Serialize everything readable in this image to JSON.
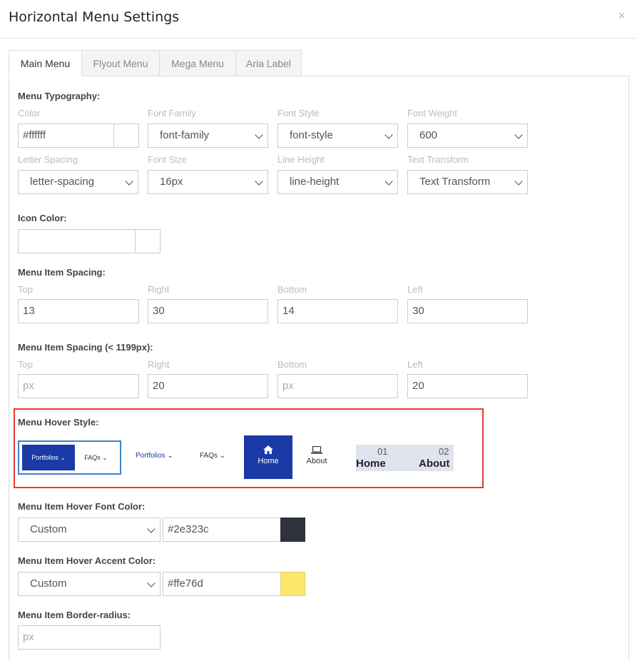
{
  "dialog": {
    "title": "Horizontal Menu Settings",
    "close_glyph": "×"
  },
  "tabs": [
    {
      "label": "Main Menu",
      "active": true
    },
    {
      "label": "Flyout Menu",
      "active": false
    },
    {
      "label": "Mega Menu",
      "active": false
    },
    {
      "label": "Aria Label",
      "active": false
    }
  ],
  "typography": {
    "heading": "Menu Typography:",
    "color_label": "Color",
    "color_value": "#ffffff",
    "font_family_label": "Font Family",
    "font_family_value": "font-family",
    "font_style_label": "Font Style",
    "font_style_value": "font-style",
    "font_weight_label": "Font Weight",
    "font_weight_value": "600",
    "letter_spacing_label": "Letter Spacing",
    "letter_spacing_value": "letter-spacing",
    "font_size_label": "Font Size",
    "font_size_value": "16px",
    "line_height_label": "Line Height",
    "line_height_value": "line-height",
    "text_transform_label": "Text Transform",
    "text_transform_value": "Text Transform"
  },
  "icon_color": {
    "heading": "Icon Color:",
    "value": ""
  },
  "spacing": {
    "heading": "Menu Item Spacing:",
    "top_label": "Top",
    "top_value": "13",
    "right_label": "Right",
    "right_value": "30",
    "bottom_label": "Bottom",
    "bottom_value": "14",
    "left_label": "Left",
    "left_value": "30"
  },
  "spacing_small": {
    "heading": "Menu Item Spacing (< 1199px):",
    "top_label": "Top",
    "top_placeholder": "px",
    "right_label": "Right",
    "right_value": "20",
    "bottom_label": "Bottom",
    "bottom_placeholder": "px",
    "left_label": "Left",
    "left_value": "20"
  },
  "hover_style": {
    "heading": "Menu Hover Style:",
    "style1": {
      "item1": "Portfolios ⌄",
      "item2": "FAQs ⌄"
    },
    "style2": {
      "item1": "Portfolios ⌄",
      "item2": "FAQs ⌄"
    },
    "style3": {
      "item1": "Home",
      "item1_icon": "home-icon",
      "item2": "About",
      "item2_icon": "laptop-icon"
    },
    "style4": {
      "num1": "01",
      "word1": "Home",
      "num2": "02",
      "word2": "About"
    },
    "selected": "style1"
  },
  "hover_font_color": {
    "heading": "Menu Item Hover Font Color:",
    "mode": "Custom",
    "value": "#2e323c",
    "swatch": "#2e323c"
  },
  "hover_accent_color": {
    "heading": "Menu Item Hover Accent Color:",
    "mode": "Custom",
    "value": "#ffe76d",
    "swatch": "#ffe76d"
  },
  "border_radius": {
    "heading": "Menu Item Border-radius:",
    "placeholder": "px"
  },
  "colors": {
    "accent_blue": "#1b3aa6",
    "highlight_red": "#e53935",
    "selected_blue": "#3a84c9"
  }
}
